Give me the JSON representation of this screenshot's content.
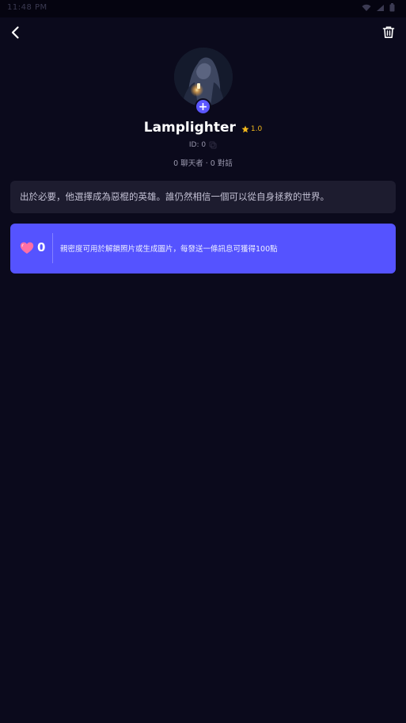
{
  "status_bar": {
    "time": "11:48 PM"
  },
  "nav": {
    "back_icon": "chevron-left-icon",
    "delete_icon": "trash-icon"
  },
  "character": {
    "name": "Lamplighter",
    "rating": "1.0",
    "id_text": "ID: 0",
    "stats": "0 聊天者 · 0 對話",
    "avatar_add_label": "+"
  },
  "description": "出於必要，他選擇成為惡棍的英雄。誰仍然相信一個可以從自身拯救的世界。",
  "intimacy": {
    "value": "0",
    "text": "親密度可用於解鎖照片或生成圖片，每發送一條訊息可獲得100點"
  },
  "colors": {
    "background": "#0b0a1c",
    "card": "#1d1c2f",
    "accent": "#5553ff",
    "star": "#f2b81c",
    "heart": "#ff6fa5"
  }
}
